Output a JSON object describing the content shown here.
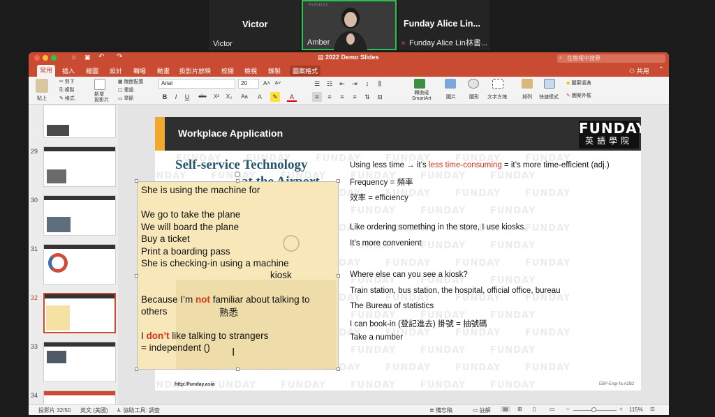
{
  "meeting": {
    "tiles": [
      {
        "name": "Victor",
        "big": "Victor"
      },
      {
        "name": "Amber",
        "watermark": "FUNDAY"
      },
      {
        "name": "Funday Alice Lin林書...",
        "big": "Funday  Alice  Lin..."
      }
    ]
  },
  "ppt": {
    "doc_title": "2022 Demo Slides",
    "search_placeholder": "在簡報中搜尋",
    "share_label": "共用",
    "tabs": [
      "常用",
      "插入",
      "繪圖",
      "設計",
      "轉場",
      "動畫",
      "投影片放映",
      "校閱",
      "檢視",
      "錄製",
      "圖案格式"
    ],
    "ribbon": {
      "paste": "貼上",
      "cut": "剪下",
      "copy": "複製",
      "format": "格式",
      "new_slide": "新增\n投影片",
      "layout": "版面配置",
      "reset": "重設",
      "section": "章節",
      "font": "Arial",
      "size": "20",
      "convert": "轉換成\nSmartArt",
      "picture": "圖片",
      "shapes": "圖形",
      "textbox": "文字方塊",
      "arrange": "排列",
      "quick_styles": "快速樣式",
      "shape_fill": "圖案填滿",
      "shape_outline": "圖案外框"
    },
    "thumb_numbers": [
      "29",
      "30",
      "31",
      "32",
      "33",
      "34"
    ],
    "status": {
      "slide_pos": "投影片 32/50",
      "lang": "英文 (美國)",
      "access": "協助工具: 調查",
      "notes": "備忘稿",
      "comments": "註解",
      "zoom": "115%"
    }
  },
  "slide": {
    "section_title": "Workplace Application",
    "logo_top": "FUNDAY",
    "logo_bottom": "英語學院",
    "watermark": "FUNDAY",
    "headline_1": "Self-service Technology",
    "headline_2": "at the Airport",
    "right_lines": {
      "l1_a": "Using less time → it’s ",
      "l1_red": "less time-consuming",
      "l1_b": " = it’s more time-efficient (adj.)",
      "l2": "Frequency = 頻率",
      "l3": "效率 = efficiency",
      "l4": "Like ordering something in the store, I use kiosks.",
      "l5": "It’s more convenient",
      "l6": "Where else can you see a kiosk?",
      "l7": "Train station, bus station, the hospital, official office, bureau",
      "l8": "The Bureau of statistics",
      "l9": "I can book-in (登記進去) 掛號 = 抽號碼",
      "l10": "Take a number"
    },
    "url": "http://funday.asia",
    "code": "EBP-Engr-fa-A2B2"
  },
  "note": {
    "n1": "She is using the machine for",
    "n2": "We go to take the plane",
    "n3": "We will board the plane",
    "n4": "Buy a ticket",
    "n5": "Print a boarding pass",
    "n6": "She is checking-in using a machine",
    "n7": "kiosk",
    "n8_a": "Because I’m ",
    "n8_red": "not",
    "n8_b": " familiar about talking to",
    "n9": "others",
    "n9_cn": "熟悉",
    "n10_a": "I ",
    "n10_red": "don’t",
    "n10_b": " like talking to strangers",
    "n11": "= independent ()"
  },
  "colors": {
    "ppt_accent": "#c84b32",
    "slide_head": "#2f2f2f",
    "slide_accent": "#f0a92c",
    "headline": "#24566e",
    "note_bg": "#f8e7b8",
    "red_text": "#d9341c"
  }
}
